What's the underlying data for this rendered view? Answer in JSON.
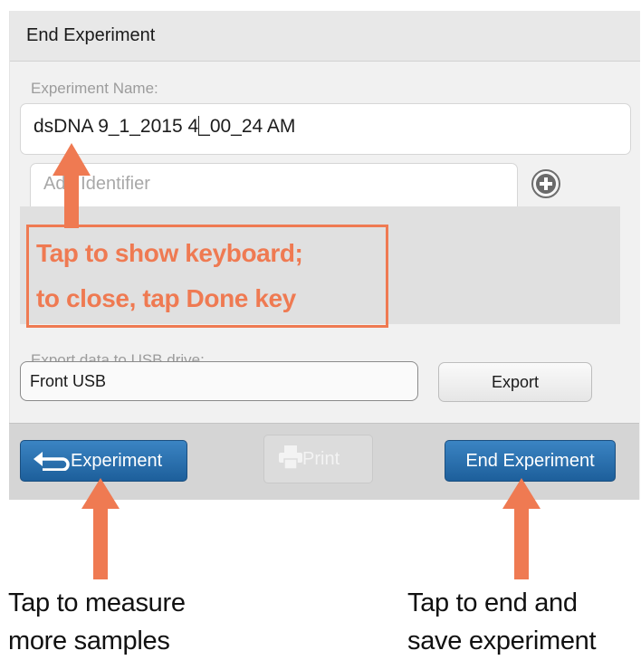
{
  "dialog": {
    "title": "End Experiment",
    "experiment_name_label": "Experiment Name:",
    "experiment_name_value_before_cursor": "dsDNA 9_1_2015 4",
    "experiment_name_value_after_cursor": "_00_24 AM",
    "identifier_placeholder": "Add Identifier",
    "add_icon": "plus-circle-icon",
    "export_label": "Export data to USB drive:",
    "usb_selected": "Front USB",
    "export_button": "Export"
  },
  "bottombar": {
    "back_button": "Experiment",
    "back_icon": "return-arrow-icon",
    "print_button": "Print",
    "print_icon": "printer-icon",
    "end_button": "End Experiment"
  },
  "annotations": {
    "keyboard_callout_line1": "Tap to show keyboard;",
    "keyboard_callout_line2": "to close, tap Done key",
    "left_caption_line1": "Tap to measure",
    "left_caption_line2": "more samples",
    "right_caption_line1": "Tap to end and",
    "right_caption_line2": "save experiment",
    "arrow_color": "#ef7a52"
  }
}
